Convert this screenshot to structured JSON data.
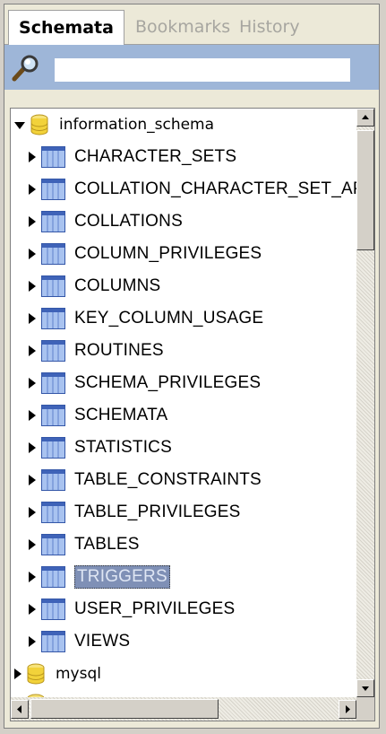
{
  "tabs": [
    {
      "label": "Schemata",
      "active": true
    },
    {
      "label": "Bookmarks",
      "active": false
    },
    {
      "label": "History",
      "active": false
    }
  ],
  "search": {
    "value": "",
    "placeholder": "",
    "icon": "search-icon"
  },
  "tree": {
    "schemas": [
      {
        "name": "information_schema",
        "expanded": true,
        "tables": [
          "CHARACTER_SETS",
          "COLLATION_CHARACTER_SET_APPLICABILITY",
          "COLLATIONS",
          "COLUMN_PRIVILEGES",
          "COLUMNS",
          "KEY_COLUMN_USAGE",
          "ROUTINES",
          "SCHEMA_PRIVILEGES",
          "SCHEMATA",
          "STATISTICS",
          "TABLE_CONSTRAINTS",
          "TABLE_PRIVILEGES",
          "TABLES",
          "TRIGGERS",
          "USER_PRIVILEGES",
          "VIEWS"
        ],
        "selected_table": "TRIGGERS"
      },
      {
        "name": "mysql",
        "expanded": false,
        "tables": []
      }
    ]
  },
  "colors": {
    "selection": "#7f90b6",
    "search_bar": "#9eb6d8",
    "db_icon": "#f2d23a",
    "table_icon": "#7f9fe0"
  }
}
